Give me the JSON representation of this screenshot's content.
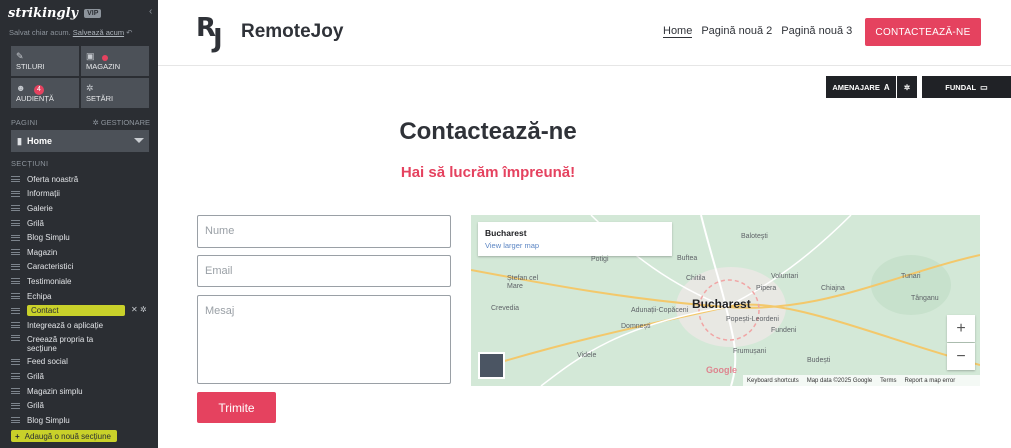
{
  "sidebar": {
    "logo": "strikingly",
    "vip_badge": "VIP",
    "saved_text": "Salvat chiar acum.",
    "save_now_link": "Salvează acum",
    "tiles": [
      {
        "label": "STILURI",
        "icon": "brush-icon"
      },
      {
        "label": "MAGAZIN",
        "icon": "bag-icon"
      },
      {
        "label": "AUDIENȚĂ",
        "icon": "users-icon",
        "badge": "4"
      },
      {
        "label": "SETĂRI",
        "icon": "gear-icon"
      }
    ],
    "pages_label": "PAGINI",
    "manage_label": "GESTIONARE",
    "current_page": "Home",
    "sections_label": "SECȚIUNI",
    "sections": [
      "Oferta noastră",
      "Informații",
      "Galerie",
      "Grilă",
      "Blog Simplu",
      "Magazin",
      "Caracteristici",
      "Testimoniale",
      "Echipa",
      "Contact",
      "Integrează o aplicație",
      "Creează propria ta secțiune",
      "Feed social",
      "Grilă",
      "Magazin simplu",
      "Grilă",
      "Blog Simplu"
    ],
    "active_section": "Contact",
    "add_section": "Adaugă o nouă secțiune"
  },
  "header": {
    "brand_initials_r": "R",
    "brand_initials_j": "J",
    "brand_name": "RemoteJoy",
    "nav": [
      "Home",
      "Pagină nouă 2",
      "Pagină nouă 3"
    ],
    "cta": "CONTACTEAZĂ-NE"
  },
  "editor": {
    "layout_button": "AMENAJARE",
    "layout_badge": "A",
    "background_button": "FUNDAL"
  },
  "contact": {
    "title": "Contactează-ne",
    "subtitle": "Hai să lucrăm împreună!",
    "name_placeholder": "Nume",
    "email_placeholder": "Email",
    "message_placeholder": "Mesaj",
    "submit": "Trimite"
  },
  "map": {
    "card_title": "Bucharest",
    "card_link": "View larger map",
    "city": "Bucharest",
    "places": [
      "Baloteşti",
      "Potigi",
      "Buftea",
      "Ștefan cel Mare",
      "Chitila",
      "Voluntari",
      "Pipera",
      "Crevedia",
      "Tânganu",
      "Domnești",
      "Popești-Leordeni",
      "Fundeni",
      "Videle",
      "Frumușani",
      "Budești",
      "Tunari",
      "Chiajna",
      "Adunații-Copăceni"
    ],
    "zoom_in": "+",
    "zoom_out": "−",
    "google_logo": "Google",
    "attribution": [
      "Keyboard shortcuts",
      "Map data ©2025 Google",
      "Terms",
      "Report a map error"
    ]
  },
  "colors": {
    "accent": "#e5425f",
    "sidebar_bg": "#2b2e33",
    "highlight": "#c9d12a",
    "map_bg": "#d3e8d7"
  }
}
